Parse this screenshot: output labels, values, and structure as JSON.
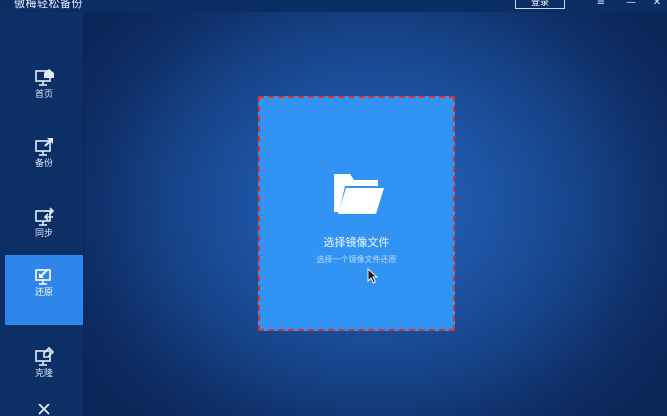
{
  "window": {
    "title": "傲梅轻松备份",
    "login_label": "登录",
    "menu_icon": "≡",
    "minimize_icon": "—",
    "close_icon": "✕"
  },
  "sidebar": {
    "items": [
      {
        "label": "首页",
        "icon": "home-icon"
      },
      {
        "label": "备份",
        "icon": "backup-icon"
      },
      {
        "label": "同步",
        "icon": "sync-icon"
      },
      {
        "label": "还原",
        "icon": "restore-icon",
        "active": true
      },
      {
        "label": "克隆",
        "icon": "clone-icon"
      },
      {
        "label": "",
        "icon": "tools-icon"
      }
    ]
  },
  "main": {
    "dropzone": {
      "title": "选择镜像文件",
      "subtitle": "选择一个镜像文件还原"
    }
  },
  "colors": {
    "sidebar_bg": "#0c2f66",
    "active_item": "#2f86ea",
    "dropzone_bg": "#3193f4",
    "dropzone_border": "#d9332e"
  }
}
